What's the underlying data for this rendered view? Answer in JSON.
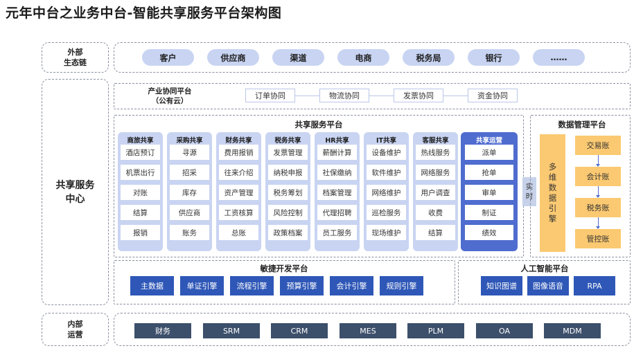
{
  "title": "元年中台之业务中台-智能共享服务平台架构图",
  "external": {
    "label_line1": "外部",
    "label_line2": "生态链",
    "items": [
      "客户",
      "供应商",
      "渠道",
      "电商",
      "税务局",
      "银行",
      "……"
    ]
  },
  "center": {
    "label_line1": "共享服务",
    "label_line2": "中心"
  },
  "industry": {
    "label_line1": "产业协同平台",
    "label_line2": "（公有云）",
    "items": [
      "订单协同",
      "物流协同",
      "发票协同",
      "资金协同"
    ]
  },
  "shared_platform": {
    "title": "共享服务平台",
    "columns": [
      {
        "header": "商旅共享",
        "items": [
          "酒店预订",
          "机票出行",
          "对账",
          "结算",
          "报销"
        ]
      },
      {
        "header": "采购共享",
        "items": [
          "寻源",
          "招采",
          "库存",
          "供应商",
          "账务"
        ]
      },
      {
        "header": "财务共享",
        "items": [
          "费用报销",
          "往来介绍",
          "资产管理",
          "工资核算",
          "总账"
        ]
      },
      {
        "header": "税务共享",
        "items": [
          "发票管理",
          "纳税申报",
          "税务筹划",
          "风险控制",
          "政策档案"
        ]
      },
      {
        "header": "HR共享",
        "items": [
          "薪酬计算",
          "社保缴纳",
          "档案管理",
          "代理招聘",
          "员工服务"
        ]
      },
      {
        "header": "IT共享",
        "items": [
          "设备维护",
          "软件维护",
          "网络维护",
          "巡检服务",
          "现场维护"
        ]
      },
      {
        "header": "客服共享",
        "items": [
          "热线服务",
          "网络服务",
          "用户调查",
          "收费",
          "结算"
        ]
      }
    ],
    "operations": {
      "header": "共享运营",
      "items": [
        "派单",
        "抢单",
        "审单",
        "制证",
        "绩效"
      ]
    }
  },
  "realtime": {
    "line1": "实",
    "line2": "时"
  },
  "data_platform": {
    "title": "数据管理平台",
    "engine_label": [
      "多",
      "维",
      "数",
      "据",
      "引",
      "擎"
    ],
    "accounts": [
      "交易账",
      "会计账",
      "税务账",
      "管控账"
    ]
  },
  "agile": {
    "title": "敏捷开发平台",
    "items": [
      "主数据",
      "单证引擎",
      "流程引擎",
      "预算引擎",
      "会计引擎",
      "规则引擎"
    ]
  },
  "ai": {
    "title": "人工智能平台",
    "items": [
      "知识图谱",
      "图像语音",
      "RPA"
    ]
  },
  "internal": {
    "label_line1": "内部",
    "label_line2": "运营",
    "items": [
      "财务",
      "SRM",
      "CRM",
      "MES",
      "PLM",
      "OA",
      "MDM"
    ]
  },
  "colors": {
    "pill": "#c8d4f2",
    "column": "#c9d4f2",
    "operations": "#4f6ccf",
    "data_bar": "#fbc971",
    "agile_button": "#2e57b7",
    "internal_button": "#3c4f6b"
  }
}
